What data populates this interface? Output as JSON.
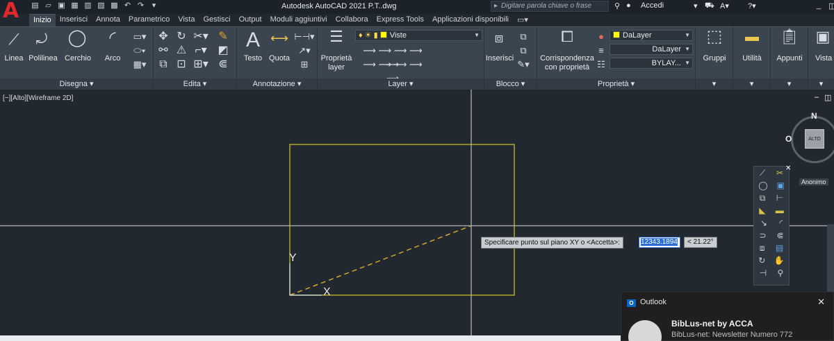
{
  "window": {
    "title": "Autodesk AutoCAD 2021    P.T..dwg",
    "search_placeholder": "Digitare parola chiave o frase",
    "signin": "Accedi"
  },
  "tabs": [
    "Inizio",
    "Inserisci",
    "Annota",
    "Parametrico",
    "Vista",
    "Gestisci",
    "Output",
    "Moduli aggiuntivi",
    "Collabora",
    "Express Tools",
    "Applicazioni disponibili"
  ],
  "ribbon": {
    "disegna": {
      "title": "Disegna",
      "linea": "Linea",
      "polilinea": "Polilinea",
      "cerchio": "Cerchio",
      "arco": "Arco"
    },
    "edita": {
      "title": "Edita"
    },
    "annotazione": {
      "title": "Annotazione",
      "testo": "Testo",
      "quota": "Quota"
    },
    "layer": {
      "title": "Layer",
      "proprieta_layer": "Proprietà layer",
      "current_layer": "Viste"
    },
    "blocco": {
      "title": "Blocco",
      "inserisci": "Inserisci"
    },
    "proprieta": {
      "title": "Proprietà",
      "corrispondenza": "Corrispondenza con proprietà",
      "color": "DaLayer",
      "linetype": "DaLayer",
      "lineweight": "BYLAY..."
    },
    "gruppi": "Gruppi",
    "utilita": "Utilità",
    "appunti": "Appunti",
    "vista": "Vista"
  },
  "viewport": {
    "label": "[−][Alto][Wireframe 2D]",
    "prompt": "Specificare punto sul piano XY o <Accetta>:",
    "distance_value": "12343.1894",
    "angle_value": "< 21.22°",
    "ucs_y": "Y",
    "ucs_x": "X"
  },
  "viewcube": {
    "north": "N",
    "west": "O",
    "face": "ALTO",
    "ucs_label": "Anonimo"
  },
  "notification": {
    "app": "Outlook",
    "sender": "BibLus-net by ACCA",
    "preview": "BibLus-net: Newsletter Numero 772"
  },
  "colors": {
    "ribbon_bg": "#3b4550",
    "canvas_bg": "#212830",
    "geometry": "#d4c92a",
    "accent": "#2b6fd6"
  }
}
